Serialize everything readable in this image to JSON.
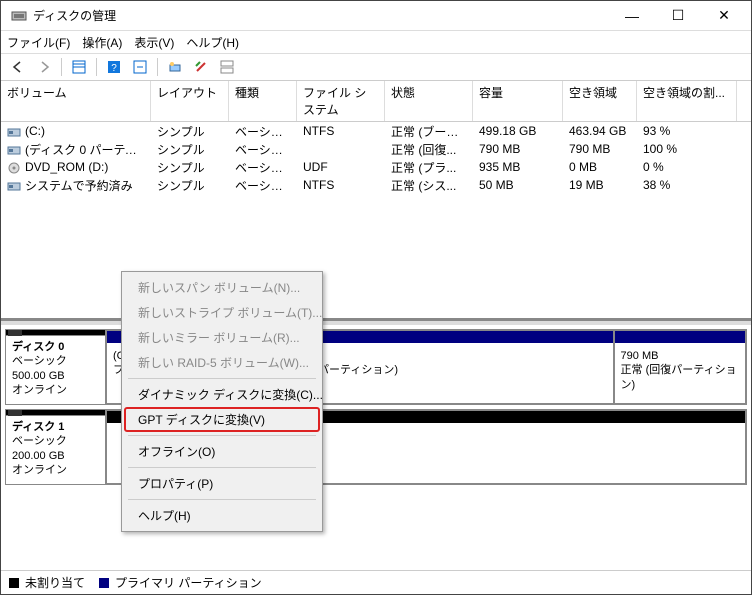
{
  "window": {
    "title": "ディスクの管理"
  },
  "menu": {
    "file": "ファイル(F)",
    "action": "操作(A)",
    "view": "表示(V)",
    "help": "ヘルプ(H)"
  },
  "columns": [
    "ボリューム",
    "レイアウト",
    "種類",
    "ファイル システム",
    "状態",
    "容量",
    "空き領域",
    "空き領域の割..."
  ],
  "volumes": [
    {
      "name": "(C:)",
      "icon": "drive",
      "layout": "シンプル",
      "type": "ベーシック",
      "fs": "NTFS",
      "status": "正常 (ブート...",
      "capacity": "499.18 GB",
      "free": "463.94 GB",
      "pct": "93 %"
    },
    {
      "name": "(ディスク 0 パーティシ...",
      "icon": "drive",
      "layout": "シンプル",
      "type": "ベーシック",
      "fs": "",
      "status": "正常 (回復...",
      "capacity": "790 MB",
      "free": "790 MB",
      "pct": "100 %"
    },
    {
      "name": "DVD_ROM (D:)",
      "icon": "disc",
      "layout": "シンプル",
      "type": "ベーシック",
      "fs": "UDF",
      "status": "正常 (プラ...",
      "capacity": "935 MB",
      "free": "0 MB",
      "pct": "0 %"
    },
    {
      "name": "システムで予約済み",
      "icon": "drive",
      "layout": "シンプル",
      "type": "ベーシック",
      "fs": "NTFS",
      "status": "正常 (シス...",
      "capacity": "50 MB",
      "free": "19 MB",
      "pct": "38 %"
    }
  ],
  "disks": [
    {
      "label": "ディスク 0",
      "type": "ベーシック",
      "size": "500.00 GB",
      "state": "オンライン",
      "partitions": [
        {
          "hidden": true
        },
        {
          "line1": "(C:)",
          "line2": "ファイル, クラッシュ ダンプ, プライマリ パーティション)",
          "flex": "5",
          "color": "blue"
        },
        {
          "line1": "790 MB",
          "line2": "正常 (回復パーティション)",
          "flex": "1.2",
          "color": "blue"
        }
      ]
    },
    {
      "label": "ディスク 1",
      "type": "ベーシック",
      "size": "200.00 GB",
      "state": "オンライン",
      "partitions": [
        {
          "hidden": true
        },
        {
          "line1": "",
          "line2": "",
          "flex": "6",
          "color": "black"
        }
      ]
    }
  ],
  "legend": {
    "unallocated": "未割り当て",
    "primary": "プライマリ パーティション"
  },
  "ctx": {
    "span": "新しいスパン ボリューム(N)...",
    "stripe": "新しいストライプ ボリューム(T)...",
    "mirror": "新しいミラー ボリューム(R)...",
    "raid5": "新しい RAID-5 ボリューム(W)...",
    "dynamic": "ダイナミック ディスクに変換(C)...",
    "gpt": "GPT ディスクに変換(V)",
    "offline": "オフライン(O)",
    "properties": "プロパティ(P)",
    "help": "ヘルプ(H)"
  }
}
